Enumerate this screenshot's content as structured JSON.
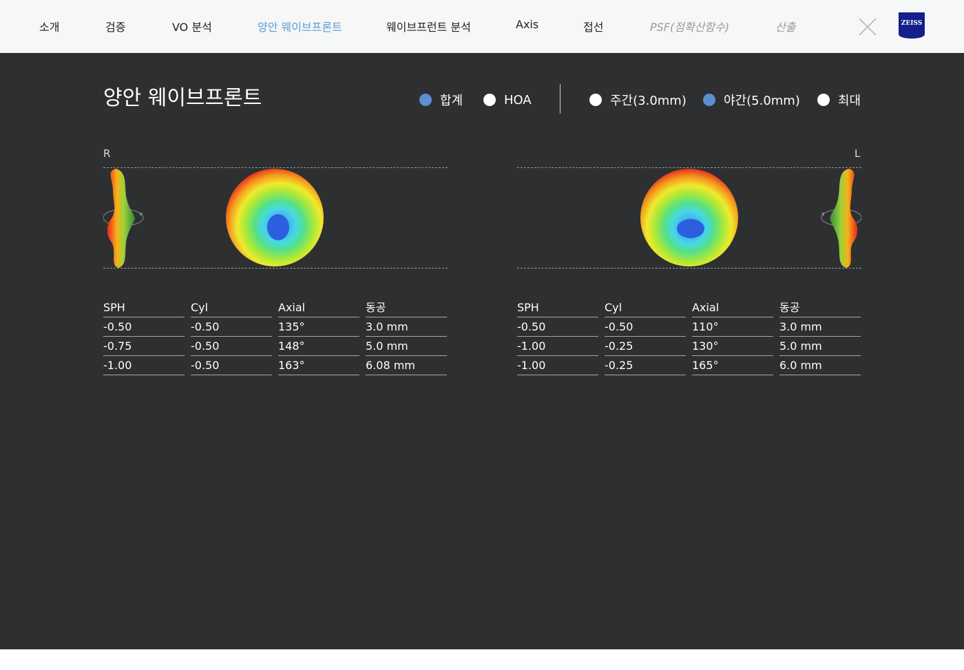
{
  "nav": {
    "items": [
      {
        "label": "소개",
        "state": "normal"
      },
      {
        "label": "검증",
        "state": "normal"
      },
      {
        "label": "VO 분석",
        "state": "normal"
      },
      {
        "label": "양안 웨이브프론트",
        "state": "active"
      },
      {
        "label": "웨이브프런트 분석",
        "state": "normal"
      },
      {
        "label": "Axis",
        "state": "normal"
      },
      {
        "label": "접선",
        "state": "normal"
      },
      {
        "label": "PSF(점확산함수)",
        "state": "disabled"
      },
      {
        "label": "산출",
        "state": "disabled"
      }
    ],
    "close_icon": "close-x-icon",
    "logo_text": "ZEISS"
  },
  "page": {
    "title": "양안 웨이브프론트"
  },
  "filters": {
    "mode": [
      {
        "label": "합계",
        "selected": true
      },
      {
        "label": "HOA",
        "selected": false
      }
    ],
    "pupil": [
      {
        "label": "주간(3.0mm)",
        "selected": false
      },
      {
        "label": "야간(5.0mm)",
        "selected": true
      },
      {
        "label": "최대",
        "selected": false
      }
    ]
  },
  "colors": {
    "accent": "#5b9bd5",
    "radio_on": "#5b8fd1",
    "background": "#2e2f31"
  },
  "eyes": {
    "right": {
      "label": "R",
      "headers": [
        "SPH",
        "Cyl",
        "Axial",
        "동공"
      ],
      "rows": [
        [
          "-0.50",
          "-0.50",
          "135°",
          "3.0 mm"
        ],
        [
          "-0.75",
          "-0.50",
          "148°",
          "5.0 mm"
        ],
        [
          "-1.00",
          "-0.50",
          "163°",
          "6.08 mm"
        ]
      ]
    },
    "left": {
      "label": "L",
      "headers": [
        "SPH",
        "Cyl",
        "Axial",
        "동공"
      ],
      "rows": [
        [
          "-0.50",
          "-0.50",
          "110°",
          "3.0 mm"
        ],
        [
          "-1.00",
          "-0.25",
          "130°",
          "5.0 mm"
        ],
        [
          "-1.00",
          "-0.25",
          "165°",
          "6.0 mm"
        ]
      ]
    }
  }
}
